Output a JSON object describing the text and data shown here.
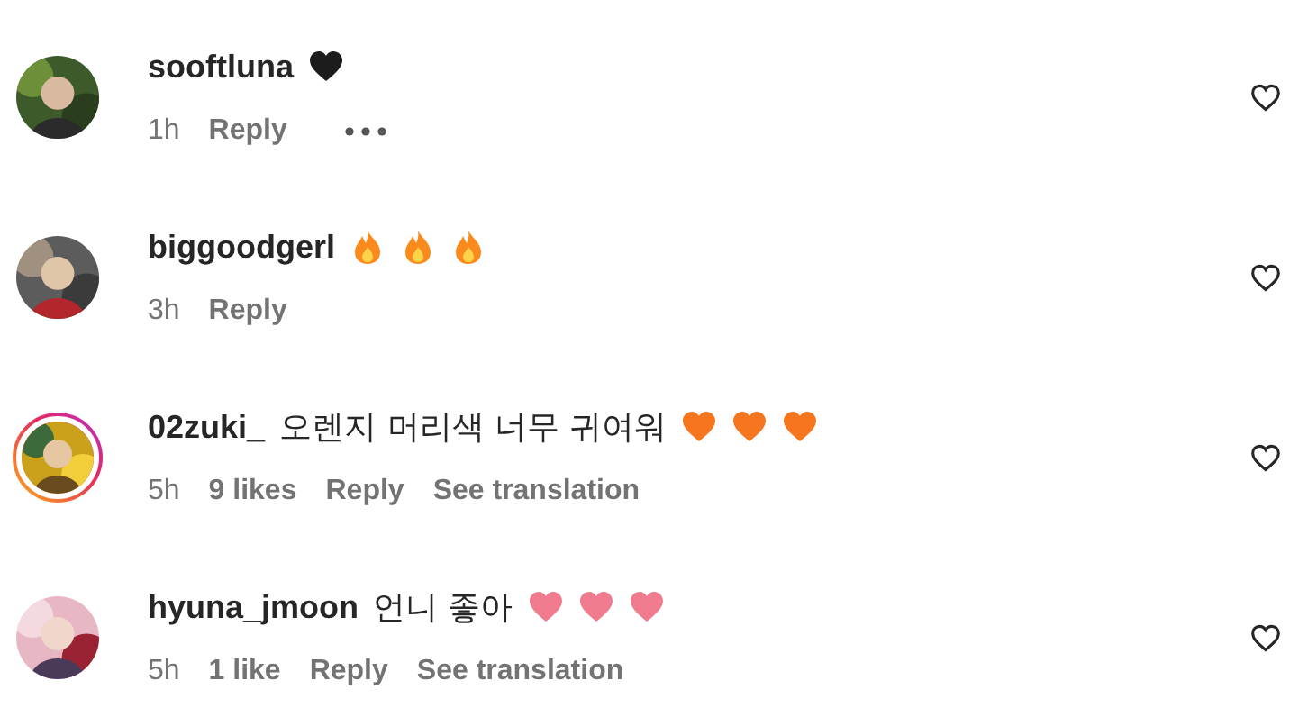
{
  "comments": [
    {
      "username": "sooftluna",
      "emojis": [
        {
          "kind": "heart",
          "color": "#1c1c1c"
        }
      ],
      "avatar": {
        "kind": "picture",
        "story_ring": false
      },
      "time": "1h",
      "reply": "Reply",
      "more_button": true
    },
    {
      "username": "biggoodgerl",
      "emojis": [
        {
          "kind": "fire",
          "color": "#f98a1b"
        },
        {
          "kind": "fire",
          "color": "#f98a1b"
        },
        {
          "kind": "fire",
          "color": "#f98a1b"
        }
      ],
      "avatar": {
        "kind": "picture",
        "story_ring": false
      },
      "time": "3h",
      "reply": "Reply",
      "more_button": false
    },
    {
      "username": "02zuki_",
      "text": "오렌지 머리색 너무 귀여워",
      "emojis": [
        {
          "kind": "heart",
          "color": "#f6761f"
        },
        {
          "kind": "heart",
          "color": "#f6761f"
        },
        {
          "kind": "heart",
          "color": "#f6761f"
        }
      ],
      "avatar": {
        "kind": "picture",
        "story_ring": true
      },
      "time": "5h",
      "likes": "9 likes",
      "reply": "Reply",
      "see_translation": "See translation",
      "more_button": false
    },
    {
      "username": "hyuna_jmoon",
      "text": "언니 좋아",
      "emojis": [
        {
          "kind": "heart",
          "color": "#f07a8e"
        },
        {
          "kind": "heart",
          "color": "#f07a8e"
        },
        {
          "kind": "heart",
          "color": "#f07a8e"
        }
      ],
      "avatar": {
        "kind": "picture",
        "story_ring": false
      },
      "time": "5h",
      "likes": "1 like",
      "reply": "Reply",
      "see_translation": "See translation",
      "more_button": false
    }
  ]
}
